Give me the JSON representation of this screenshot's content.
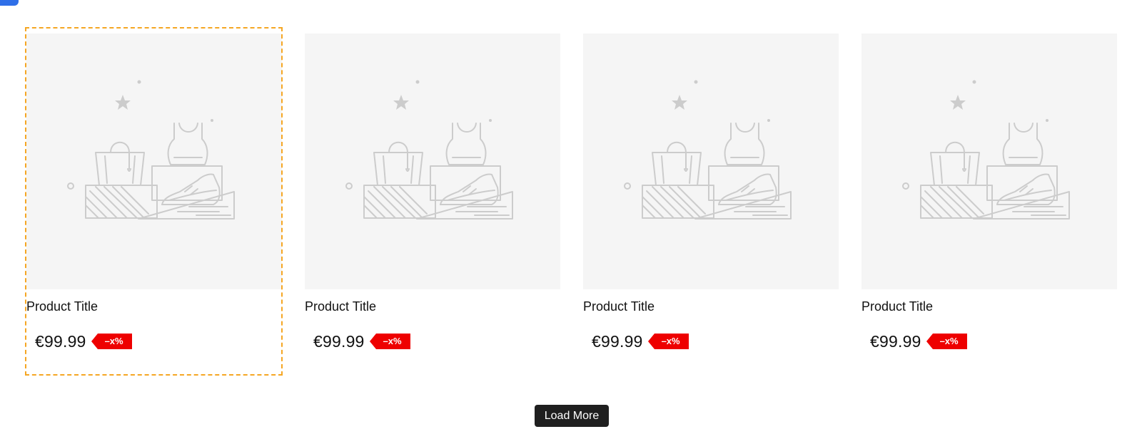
{
  "products": [
    {
      "title": "Product Title",
      "price": "€99.99",
      "badge": "–x%",
      "selected": true,
      "image_icon": "product-placeholder-icon"
    },
    {
      "title": "Product Title",
      "price": "€99.99",
      "badge": "–x%",
      "selected": false,
      "image_icon": "product-placeholder-icon"
    },
    {
      "title": "Product Title",
      "price": "€99.99",
      "badge": "–x%",
      "selected": false,
      "image_icon": "product-placeholder-icon"
    },
    {
      "title": "Product Title",
      "price": "€99.99",
      "badge": "–x%",
      "selected": false,
      "image_icon": "product-placeholder-icon"
    }
  ],
  "load_more": {
    "label": "Load More"
  },
  "colors": {
    "selection_outline": "#f5a623",
    "badge_bg": "#ee0000",
    "button_bg": "#1f1f1f",
    "thumb_bg": "#f5f5f5",
    "placeholder_stroke": "#cccccc",
    "corner_tab": "#2f6fe8"
  }
}
